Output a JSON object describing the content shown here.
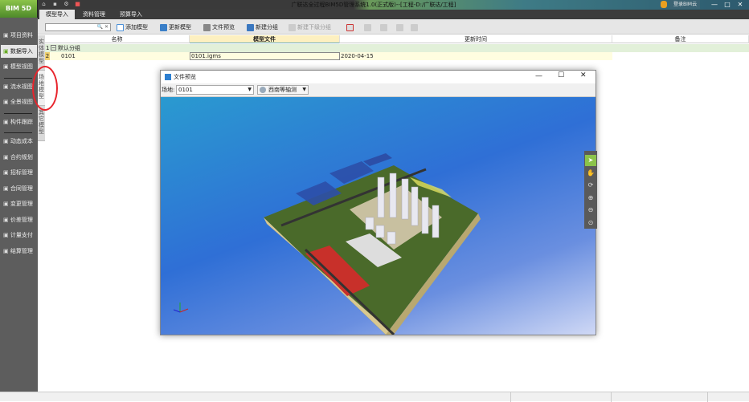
{
  "app": {
    "logo": "BIM 5D",
    "title": "广联达全过程BIM5D管理系统1.0(正式版)--[工程-D:/广联达/工程]",
    "login": "登录BIM云",
    "min": "—",
    "max": "□",
    "close": "✕"
  },
  "tabs": [
    {
      "label": "模型导入",
      "active": true
    },
    {
      "label": "资料管理"
    },
    {
      "label": "预算导入"
    }
  ],
  "sidebar": [
    {
      "label": "项目资料",
      "icon": "folder-icon"
    },
    {
      "label": "数据导入",
      "icon": "import-icon",
      "active": true
    },
    {
      "label": "模型视图",
      "icon": "model-icon"
    },
    {
      "sep": true
    },
    {
      "label": "流水视图",
      "icon": "flow-icon"
    },
    {
      "label": "全景视图",
      "icon": "panorama-icon"
    },
    {
      "sep": true
    },
    {
      "label": "构件跟踪",
      "icon": "monitor-icon"
    },
    {
      "sep": true
    },
    {
      "label": "动态成本",
      "icon": "cost-icon"
    },
    {
      "label": "合约规划",
      "icon": "contract-icon"
    },
    {
      "label": "招标管理",
      "icon": "tender-icon"
    },
    {
      "label": "合同管理",
      "icon": "document-icon"
    },
    {
      "label": "变更管理",
      "icon": "change-icon"
    },
    {
      "label": "价差管理",
      "icon": "price-icon"
    },
    {
      "label": "计量支付",
      "icon": "payment-icon"
    },
    {
      "label": "结算管理",
      "icon": "settle-icon"
    }
  ],
  "toolbar": {
    "search_placeholder": "",
    "items": [
      {
        "label": "添加模型",
        "color": "#4a8fd8"
      },
      {
        "label": "更新模型",
        "color": "#3a7fc8"
      },
      {
        "label": "文件预览",
        "color": "#777"
      },
      {
        "label": "新建分组",
        "color": "#3b78c0"
      },
      {
        "label": "新建下级分组",
        "color": "#aaa",
        "disabled": true
      }
    ]
  },
  "side_tabs": [
    "实体模型",
    "场地模型",
    "其它模型"
  ],
  "grid": {
    "columns": [
      "名称",
      "模型文件",
      "更新时间",
      "备注"
    ],
    "rows": [
      {
        "num": "1",
        "name": "默认分组",
        "file": "",
        "time": "",
        "note": "",
        "group": true
      },
      {
        "num": "2",
        "name": "0101",
        "file": "0101.igms",
        "time": "2020-04-15",
        "note": ""
      }
    ]
  },
  "dialog": {
    "title": "文件预览",
    "site_label": "场地:",
    "site_value": "0101",
    "view_value": "西南等轴测",
    "view_tools": [
      "pointer-icon",
      "pan-hand-icon",
      "orbit-icon",
      "zoom-in-icon",
      "zoom-out-icon",
      "zoom-fit-icon"
    ]
  },
  "colors": {
    "accent": "#8bc34a",
    "sidebar": "#5d5d5d",
    "selected_row": "#fffde0",
    "group_row": "#e2f0d9"
  }
}
